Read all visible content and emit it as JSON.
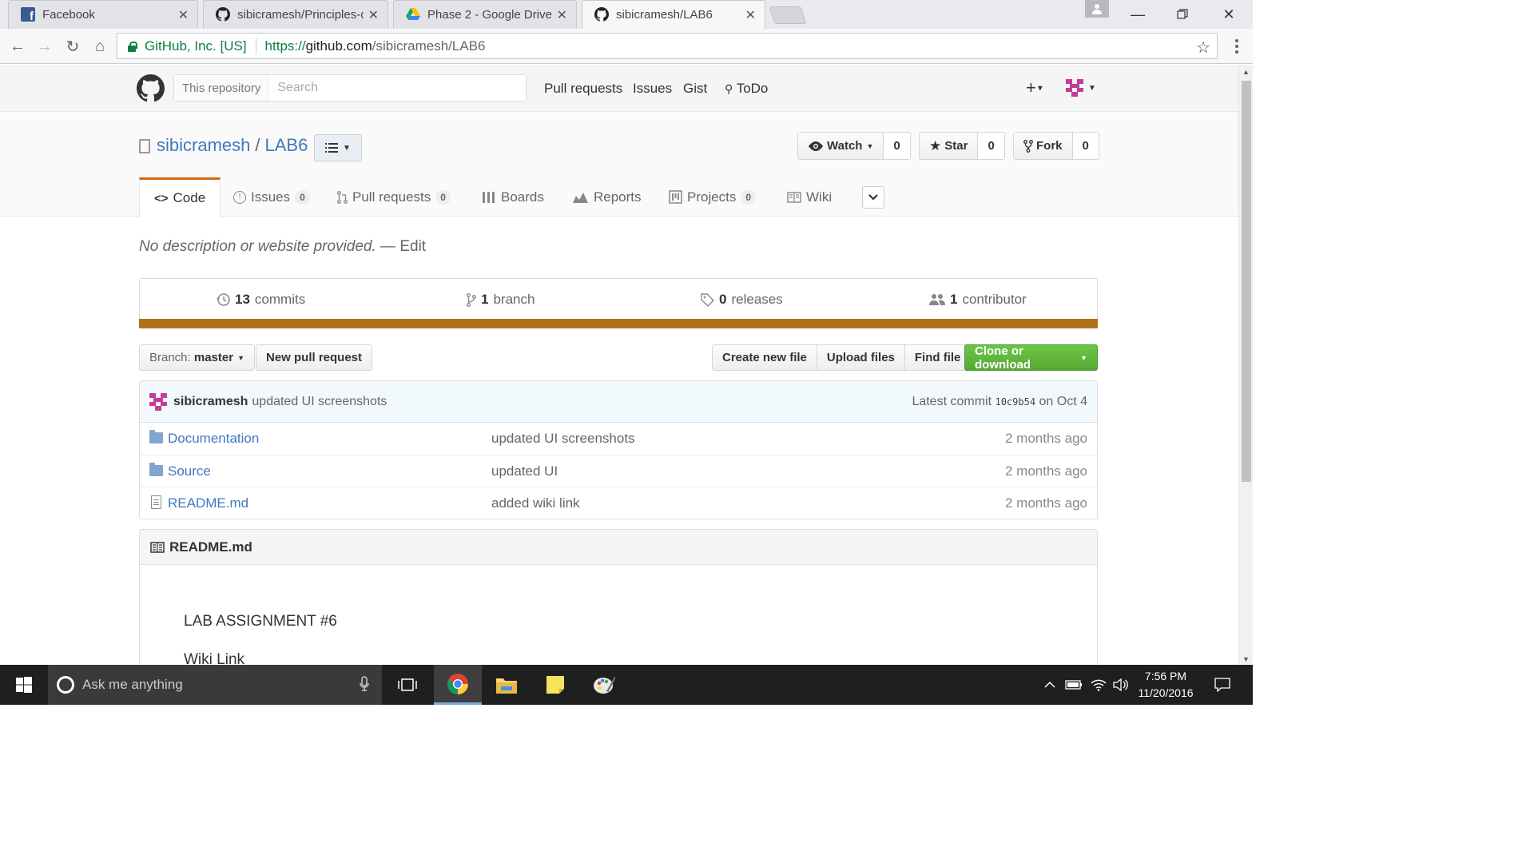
{
  "browser": {
    "tabs": [
      {
        "title": "Facebook",
        "icon": "facebook-icon"
      },
      {
        "title": "sibicramesh/Principles-of",
        "icon": "github-icon"
      },
      {
        "title": "Phase 2 - Google Drive",
        "icon": "google-drive-icon"
      },
      {
        "title": "sibicramesh/LAB6",
        "icon": "github-icon",
        "active": true
      }
    ],
    "ev_label": "GitHub, Inc. [US]",
    "url_scheme": "https://",
    "url_host": "github.com",
    "url_path": "/sibicramesh/LAB6"
  },
  "header": {
    "search_scope": "This repository",
    "search_placeholder": "Search",
    "nav": [
      "Pull requests",
      "Issues",
      "Gist",
      "ToDo"
    ],
    "plus": "+"
  },
  "repo": {
    "owner": "sibicramesh",
    "separator": "/",
    "name": "LAB6",
    "watch": {
      "label": "Watch",
      "count": "0"
    },
    "star": {
      "label": "Star",
      "count": "0"
    },
    "fork": {
      "label": "Fork",
      "count": "0"
    },
    "tabs": {
      "code": {
        "label": "Code"
      },
      "issues": {
        "label": "Issues",
        "count": "0"
      },
      "pulls": {
        "label": "Pull requests",
        "count": "0"
      },
      "boards": {
        "label": "Boards"
      },
      "reports": {
        "label": "Reports"
      },
      "projects": {
        "label": "Projects",
        "count": "0"
      },
      "wiki": {
        "label": "Wiki"
      }
    },
    "description": "No description or website provided.",
    "desc_sep": " — ",
    "edit": "Edit",
    "summary": {
      "commits": {
        "num": "13",
        "label": "commits"
      },
      "branches": {
        "num": "1",
        "label": "branch"
      },
      "releases": {
        "num": "0",
        "label": "releases"
      },
      "contributors": {
        "num": "1",
        "label": "contributor"
      }
    },
    "language_color": "#b07219",
    "branch_prefix": "Branch:",
    "branch": "master",
    "new_pr": "New pull request",
    "create_file": "Create new file",
    "upload_files": "Upload files",
    "find_file": "Find file",
    "clone": "Clone or download",
    "commit": {
      "author": "sibicramesh",
      "message": "updated UI screenshots",
      "latest_prefix": "Latest commit",
      "sha": "10c9b54",
      "date": "on Oct 4"
    },
    "files": [
      {
        "name": "Documentation",
        "type": "folder",
        "message": "updated UI screenshots",
        "age": "2 months ago"
      },
      {
        "name": "Source",
        "type": "folder",
        "message": "updated UI",
        "age": "2 months ago"
      },
      {
        "name": "README.md",
        "type": "file",
        "message": "added wiki link",
        "age": "2 months ago"
      }
    ],
    "readme": {
      "title": "README.md",
      "heading": "LAB ASSIGNMENT #6",
      "line2": "Wiki Link"
    }
  },
  "taskbar": {
    "search_placeholder": "Ask me anything",
    "time": "7:56 PM",
    "date": "11/20/2016"
  },
  "colors": {
    "link": "#4078c0",
    "green_button": "#6cc644",
    "tab_accent": "#d26911"
  }
}
